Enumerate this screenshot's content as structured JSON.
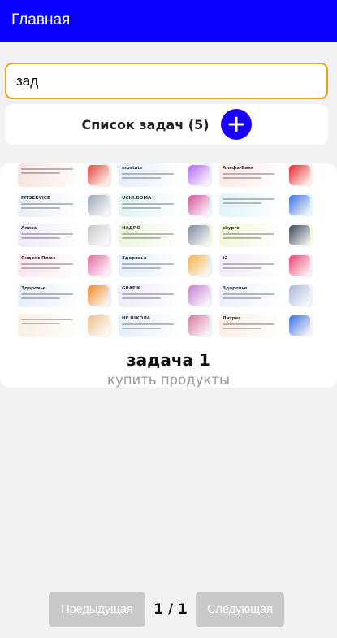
{
  "appbar": {
    "title": "Главная"
  },
  "search": {
    "value": "зад",
    "placeholder": ""
  },
  "list": {
    "label": "Список задач (5)",
    "add_icon": "plus-icon"
  },
  "tiles": [
    {
      "brand": "",
      "bg": "#f6e3e0",
      "art": "#e0473b"
    },
    {
      "brand": "mpstats",
      "bg": "#e5eef9",
      "art": "#b56cf0"
    },
    {
      "brand": "Альфа-Банк",
      "bg": "#fde8e6",
      "art": "#e4262a"
    },
    {
      "brand": "FITSERVICE",
      "bg": "#e9eef5",
      "art": "#9aa7b8"
    },
    {
      "brand": "UCHI.DOMA",
      "bg": "#dff3f5",
      "art": "#d1569b"
    },
    {
      "brand": "",
      "bg": "#e0f5f8",
      "art": "#3f6fe0"
    },
    {
      "brand": "Алиса",
      "bg": "#efe9fb",
      "art": "#c8c8c8"
    },
    {
      "brand": "НАДПО",
      "bg": "#eaf7dc",
      "art": "#7d8a9c"
    },
    {
      "brand": "skypro",
      "bg": "#f2f8d8",
      "art": "#3b4557"
    },
    {
      "brand": "Яндекс Плюс",
      "bg": "#fbe6ef",
      "art": "#e56aa8"
    },
    {
      "brand": "Здоровье",
      "bg": "#e4f1fb",
      "art": "#f0b24a"
    },
    {
      "brand": "t2",
      "bg": "#f3ecf8",
      "art": "#e8446f"
    },
    {
      "brand": "Здоровье",
      "bg": "#e6eefb",
      "art": "#f08a2a"
    },
    {
      "brand": "GRAFIK",
      "bg": "#efeaf8",
      "art": "#c47fd0"
    },
    {
      "brand": "Здоровье",
      "bg": "#eaf0fb",
      "art": "#a9b6d8"
    },
    {
      "brand": "",
      "bg": "#f9efe4",
      "art": "#e9c08e"
    },
    {
      "brand": "НЕ ШКОЛА",
      "bg": "#e6f0f8",
      "art": "#d97aa4"
    },
    {
      "brand": "Литрес",
      "bg": "#fbeee4",
      "art": "#3b6fe0"
    }
  ],
  "task": {
    "title": "задача 1",
    "description": "купить продукты"
  },
  "pager": {
    "prev_label": "Предыдущая",
    "page": "1 / 1",
    "next_label": "Следующая"
  }
}
